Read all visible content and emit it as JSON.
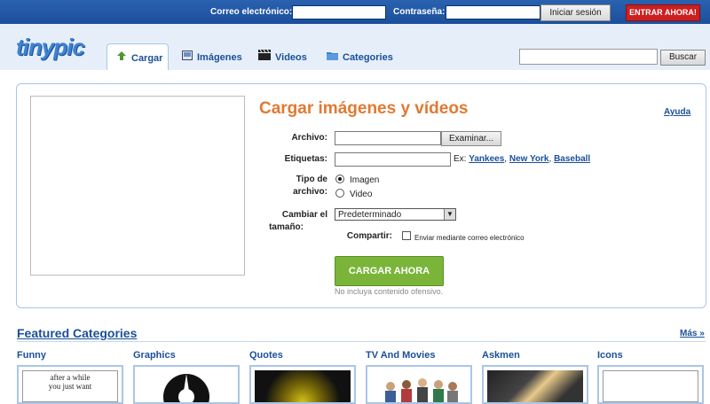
{
  "login": {
    "email_label": "Correo electrónico:",
    "password_label": "Contraseña:",
    "email_value": "",
    "password_value": "",
    "login_button": "Iniciar sesión",
    "register_button": "ENTRAR AHORA!"
  },
  "logo": "tinypic",
  "tabs": [
    {
      "label": "Cargar",
      "icon": "upload-arrow-icon"
    },
    {
      "label": "Imágenes",
      "icon": "images-icon"
    },
    {
      "label": "Videos",
      "icon": "clapperboard-icon"
    },
    {
      "label": "Categories",
      "icon": "folder-icon"
    }
  ],
  "search": {
    "value": "",
    "button": "Buscar"
  },
  "upload": {
    "title": "Cargar imágenes y vídeos",
    "help": "Ayuda",
    "file_label": "Archivo:",
    "browse_button": "Examinar...",
    "tags_label": "Etiquetas:",
    "tags_example_prefix": "Ex:",
    "tags_examples": [
      "Yankees",
      "New York",
      "Baseball"
    ],
    "type_label_1": "Tipo de",
    "type_label_2": "archivo:",
    "type_options": [
      "Imagen",
      "Video"
    ],
    "type_selected": "Imagen",
    "resize_label_1": "Cambiar el",
    "resize_label_2": "tamaño:",
    "resize_value": "Predeterminado",
    "share_label": "Compartir:",
    "share_option": "Enviar mediante correo electrónico",
    "submit": "CARGAR AHORA",
    "notice": "No incluya contenido ofensivo."
  },
  "featured": {
    "title": "Featured Categories",
    "more": "Más »",
    "categories": [
      "Funny",
      "Graphics",
      "Quotes",
      "TV And Movies",
      "Askmen",
      "Icons"
    ],
    "funny_thumb_text_1": "after a while",
    "funny_thumb_text_2": "you just want"
  }
}
